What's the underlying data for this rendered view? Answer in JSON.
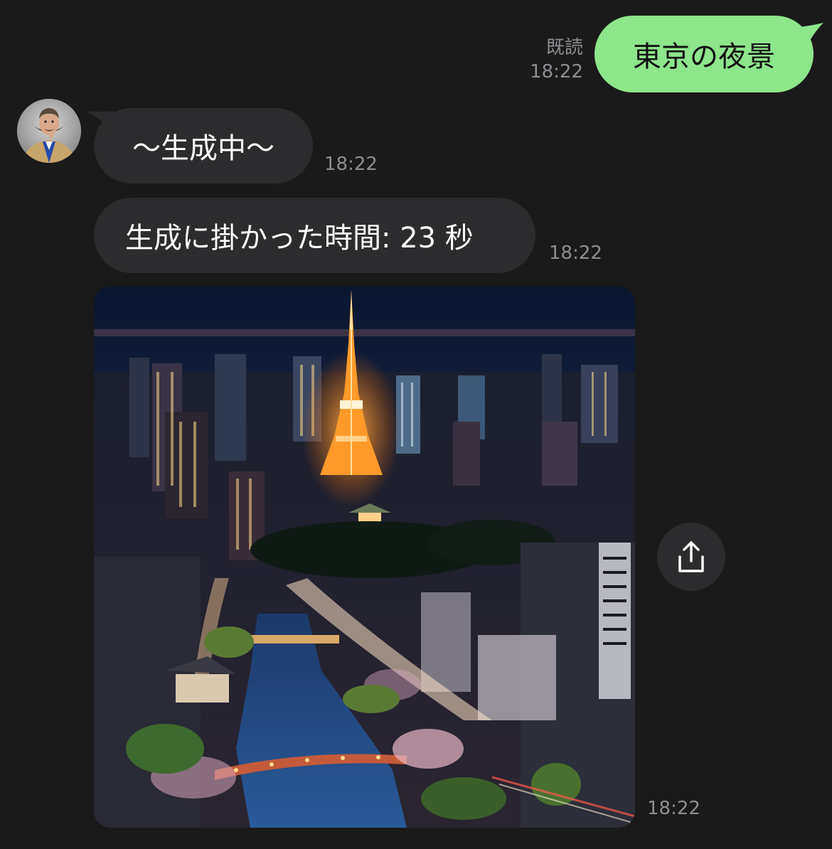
{
  "outgoing": {
    "text": "東京の夜景",
    "read_label": "既読",
    "time": "18:22"
  },
  "incoming": [
    {
      "text": "～生成中～",
      "time": "18:22"
    },
    {
      "text": "生成に掛かった時間: 23 秒",
      "time": "18:22"
    }
  ],
  "image_message": {
    "time": "18:22",
    "icon": "share-icon"
  },
  "colors": {
    "background": "#1a1a1a",
    "outgoing_bubble": "#8de68a",
    "incoming_bubble": "#2c2c2e",
    "timestamp": "#8e8e93"
  }
}
